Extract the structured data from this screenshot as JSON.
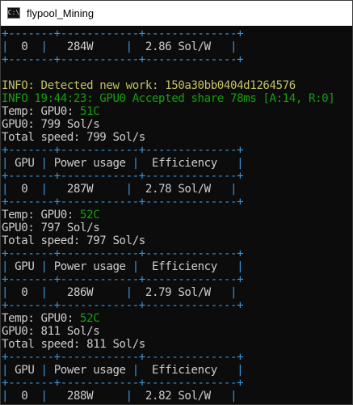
{
  "window": {
    "title": "flypool_Mining",
    "icon_text": "C:\\"
  },
  "console": {
    "lines": [
      {
        "type": "border",
        "text": "+-------+------------+--------------+"
      },
      {
        "type": "row",
        "cells": [
          "  0  ",
          "   284W     ",
          "  2.86 Sol/W   "
        ]
      },
      {
        "type": "border",
        "text": "+-------+------------+--------------+"
      },
      {
        "type": "blank",
        "text": ""
      },
      {
        "type": "info",
        "text": "INFO: Detected new work: 150a30bb0404d1264576"
      },
      {
        "type": "accepted",
        "text": "INFO 19:44:23: GPU0 Accepted share 78ms [A:14, R:0]"
      },
      {
        "type": "temp",
        "prefix": "Temp: GPU0: ",
        "value": "51C"
      },
      {
        "type": "plain",
        "text": "GPU0: 799 Sol/s"
      },
      {
        "type": "plain",
        "text": "Total speed: 799 Sol/s"
      },
      {
        "type": "border",
        "text": "+-------+------------+--------------+"
      },
      {
        "type": "row",
        "cells": [
          " GPU ",
          " Power usage ",
          "  Efficiency   "
        ]
      },
      {
        "type": "border",
        "text": "+-------+------------+--------------+"
      },
      {
        "type": "row",
        "cells": [
          "  0  ",
          "   287W     ",
          "  2.78 Sol/W   "
        ]
      },
      {
        "type": "border",
        "text": "+-------+------------+--------------+"
      },
      {
        "type": "temp",
        "prefix": "Temp: GPU0: ",
        "value": "52C"
      },
      {
        "type": "plain",
        "text": "GPU0: 797 Sol/s"
      },
      {
        "type": "plain",
        "text": "Total speed: 797 Sol/s"
      },
      {
        "type": "border",
        "text": "+-------+------------+--------------+"
      },
      {
        "type": "row",
        "cells": [
          " GPU ",
          " Power usage ",
          "  Efficiency   "
        ]
      },
      {
        "type": "border",
        "text": "+-------+------------+--------------+"
      },
      {
        "type": "row",
        "cells": [
          "  0  ",
          "   286W     ",
          "  2.79 Sol/W   "
        ]
      },
      {
        "type": "border",
        "text": "+-------+------------+--------------+"
      },
      {
        "type": "temp",
        "prefix": "Temp: GPU0: ",
        "value": "52C"
      },
      {
        "type": "plain",
        "text": "GPU0: 811 Sol/s"
      },
      {
        "type": "plain",
        "text": "Total speed: 811 Sol/s"
      },
      {
        "type": "border",
        "text": "+-------+------------+--------------+"
      },
      {
        "type": "row",
        "cells": [
          " GPU ",
          " Power usage ",
          "  Efficiency   "
        ]
      },
      {
        "type": "border",
        "text": "+-------+------------+--------------+"
      },
      {
        "type": "row",
        "cells": [
          "  0  ",
          "   288W     ",
          "  2.82 Sol/W   "
        ]
      },
      {
        "type": "border",
        "text": "+-------+------------+--------------+"
      }
    ]
  },
  "colors": {
    "border": "#3a96dd",
    "text": "#cccccc",
    "info": "#c1c166",
    "accepted": "#13a10e",
    "temp_value": "#13a10e"
  }
}
